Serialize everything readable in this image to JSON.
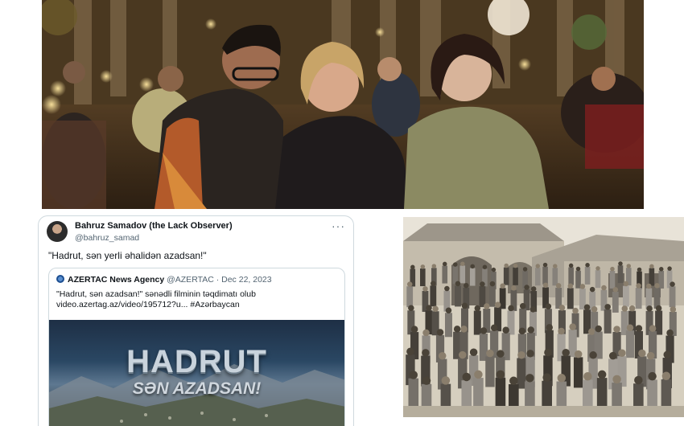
{
  "top_photo": {
    "icon": "group-photo-restaurant"
  },
  "tweet": {
    "author_name": "Bahruz Samadov (the Lack Observer)",
    "author_handle": "@bahruz_samad",
    "more_icon": "more-dots-icon",
    "text": "\"Hadrut, sən yerli əhalidən azadsan!\"",
    "quote": {
      "source_name": "AZERTAC News Agency",
      "source_meta": "@AZERTAC · Dec 22, 2023",
      "body_line1": "\"Hadrut, sən azadsan!\" sənədli filminin təqdimatı olub",
      "body_line2": "video.azertag.az/video/195712?u... #Azərbaycan",
      "media_title_line1": "HADRUT",
      "media_title_line2": "SƏN AZADSAN!"
    }
  },
  "archive_photo": {
    "icon": "historical-group-photo"
  },
  "colors": {
    "border": "#cfd9de",
    "muted": "#536471",
    "text": "#0f1419"
  }
}
